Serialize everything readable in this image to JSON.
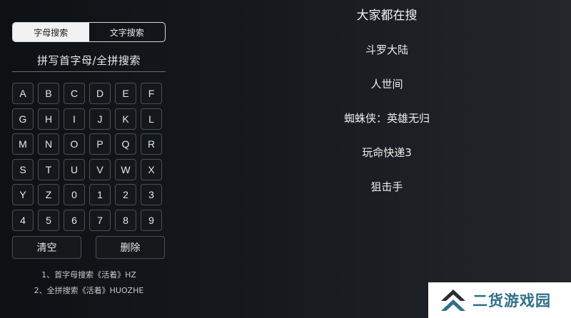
{
  "search_tabs": [
    {
      "label": "字母搜索",
      "active": true
    },
    {
      "label": "文字搜索",
      "active": false
    }
  ],
  "hint_title": "拼写首字母/全拼搜索",
  "keyboard": {
    "keys": [
      "A",
      "B",
      "C",
      "D",
      "E",
      "F",
      "G",
      "H",
      "I",
      "J",
      "K",
      "L",
      "M",
      "N",
      "O",
      "P",
      "Q",
      "R",
      "S",
      "T",
      "U",
      "V",
      "W",
      "X",
      "Y",
      "Z",
      "0",
      "1",
      "2",
      "3",
      "4",
      "5",
      "6",
      "7",
      "8",
      "9"
    ],
    "clear_label": "清空",
    "delete_label": "删除"
  },
  "tips": [
    "1、首字母搜索《活着》HZ",
    "2、全拼搜索《活着》HUOZHE"
  ],
  "hot_search": {
    "title": "大家都在搜",
    "items": [
      "斗罗大陆",
      "人世间",
      "蜘蛛侠：英雄无归",
      "玩命快递3",
      "狙击手"
    ]
  },
  "watermark": {
    "text": "二货游戏园",
    "text_color": "#2f6f8a",
    "logo_icon": "double-chevron-up-logo"
  }
}
